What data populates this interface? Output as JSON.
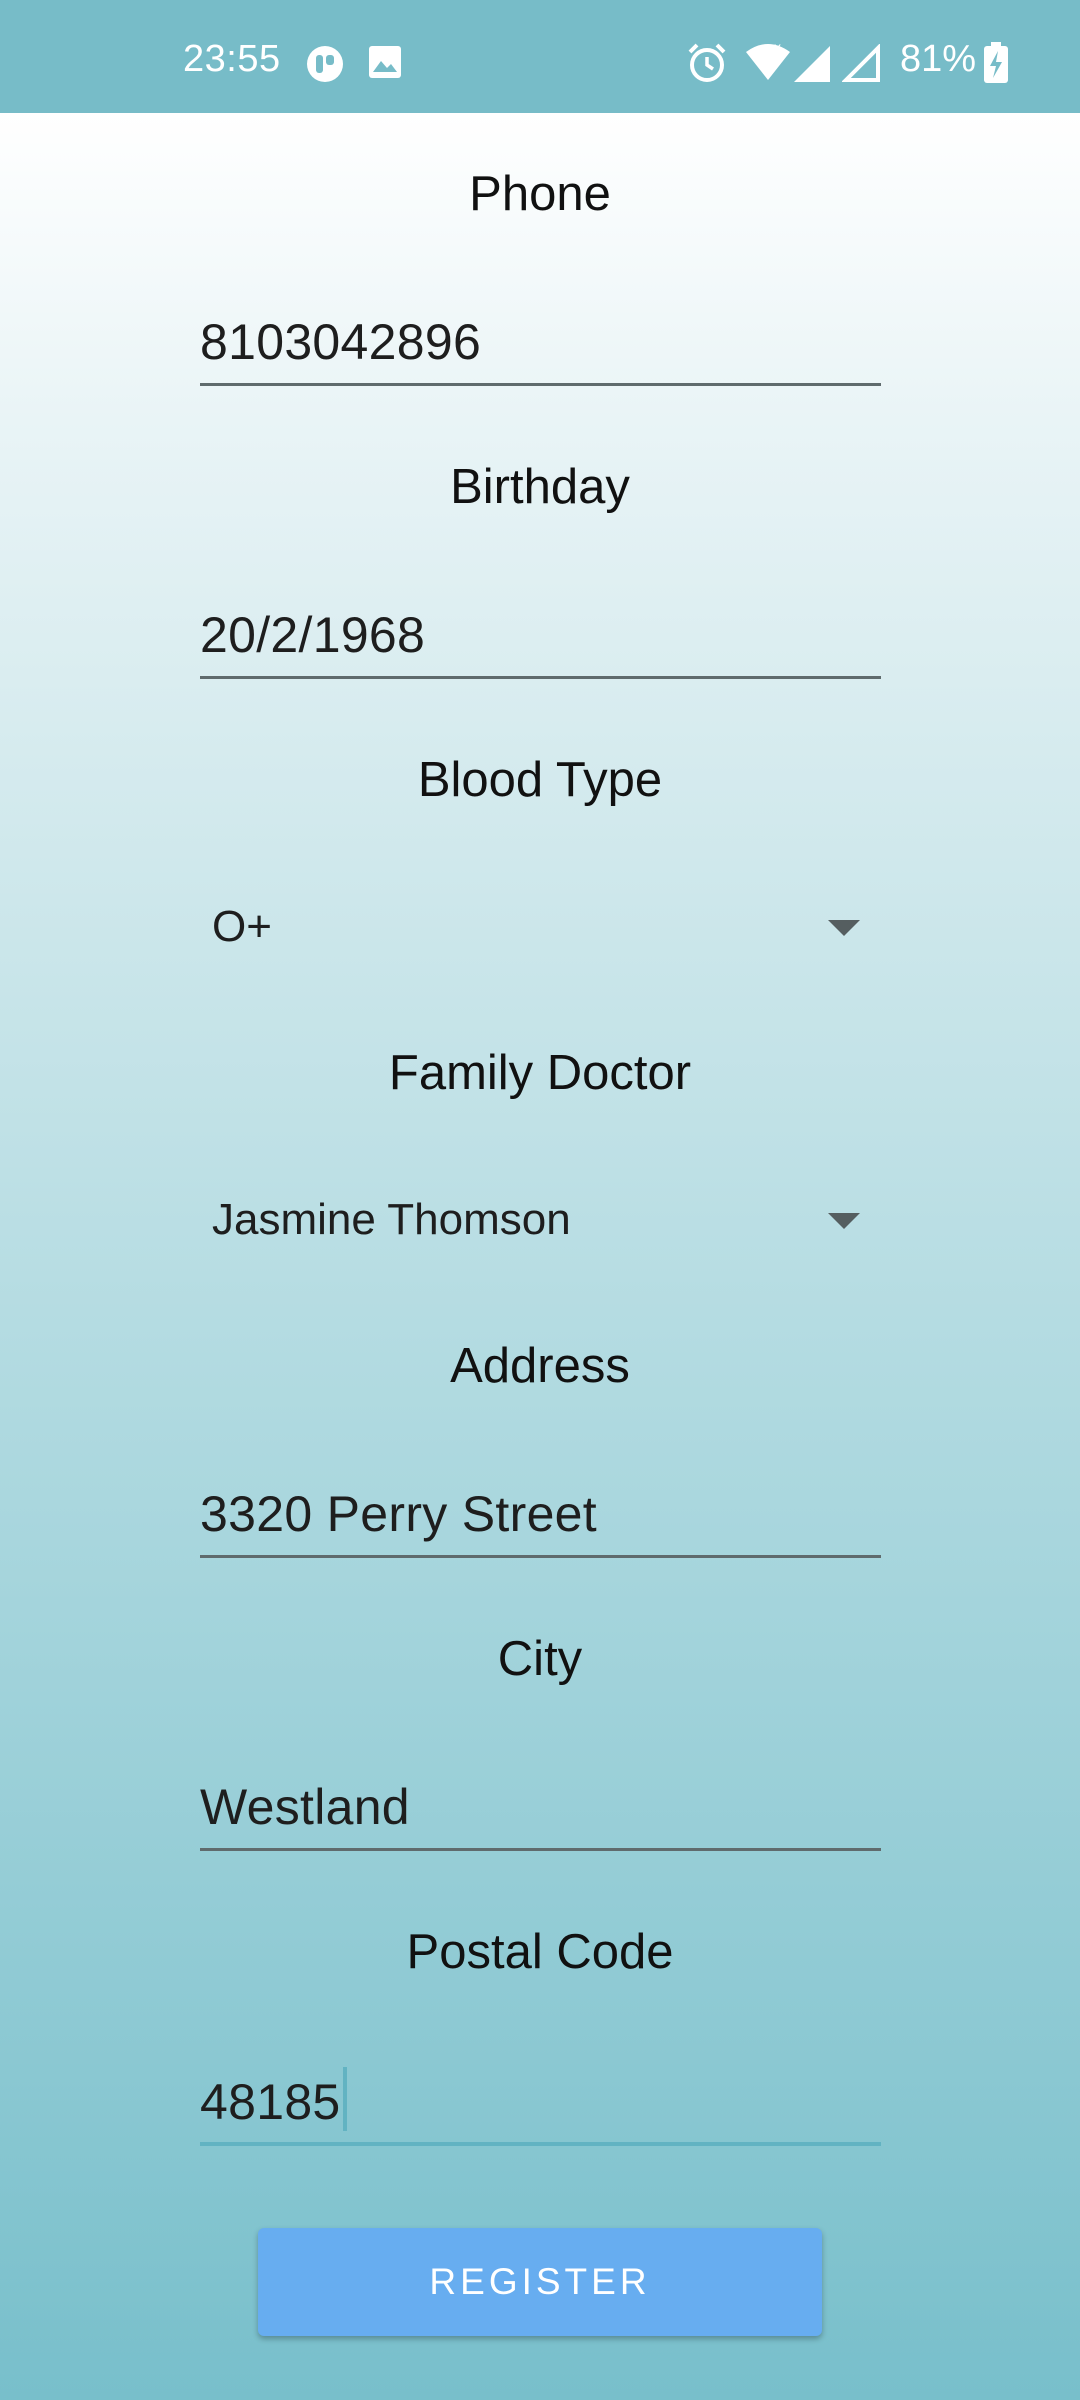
{
  "status_bar": {
    "time": "23:55",
    "battery": "81%",
    "icons": [
      "notification-app-icon",
      "image-icon",
      "alarm-icon",
      "wifi-icon",
      "signal-icon",
      "signal-empty-icon",
      "battery-charging-icon"
    ]
  },
  "form": {
    "phone": {
      "label": "Phone",
      "value": "8103042896"
    },
    "birthday": {
      "label": "Birthday",
      "value": "20/2/1968"
    },
    "blood_type": {
      "label": "Blood Type",
      "value": "O+"
    },
    "family_doctor": {
      "label": "Family Doctor",
      "value": "Jasmine Thomson"
    },
    "address": {
      "label": "Address",
      "value": "3320 Perry Street"
    },
    "city": {
      "label": "City",
      "value": "Westland"
    },
    "postal_code": {
      "label": "Postal Code",
      "value": "48185"
    }
  },
  "register_button": {
    "label": "REGISTER"
  },
  "colors": {
    "status_bar": "#77bcc8",
    "accent": "#62b3c2",
    "button": "#67adf0"
  }
}
